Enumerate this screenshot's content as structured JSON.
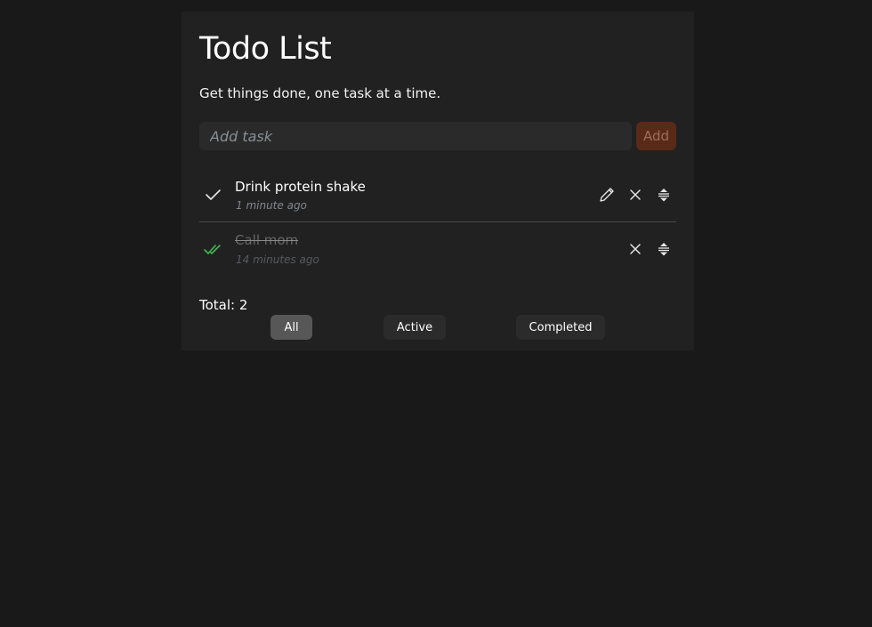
{
  "app": {
    "title": "Todo List",
    "subtitle": "Get things done, one task at a time."
  },
  "add_form": {
    "placeholder": "Add task",
    "value": "",
    "button_label": "Add"
  },
  "tasks": [
    {
      "text": "Drink protein shake",
      "time": "1 minute ago",
      "completed": false
    },
    {
      "text": "Call mom",
      "time": "14 minutes ago",
      "completed": true
    }
  ],
  "footer": {
    "total_label": "Total: 2",
    "filters": [
      {
        "label": "All",
        "selected": true
      },
      {
        "label": "Active",
        "selected": false
      },
      {
        "label": "Completed",
        "selected": false
      }
    ]
  },
  "colors": {
    "background": "#191919",
    "card": "#212121",
    "accent": "#5a2a18",
    "done_check": "#3fb950"
  },
  "icons": {
    "task_pending": "check-icon",
    "task_done": "double-check-icon",
    "edit": "pencil-icon",
    "delete": "close-icon",
    "reorder": "drag-handle-icon"
  }
}
